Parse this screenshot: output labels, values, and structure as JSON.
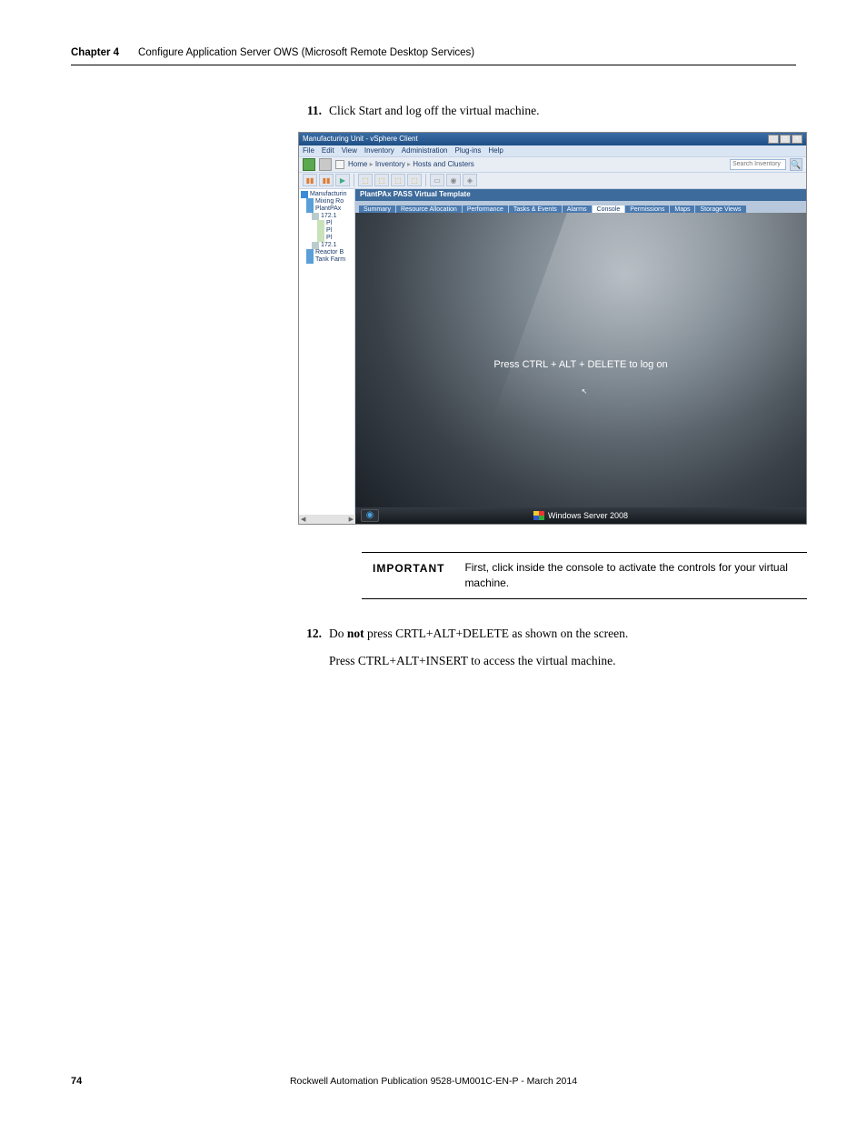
{
  "header": {
    "chapter_label": "Chapter 4",
    "chapter_title": "Configure Application Server OWS (Microsoft Remote Desktop Services)"
  },
  "steps": {
    "s11": {
      "num": "11.",
      "text": "Click Start and log off the virtual machine."
    },
    "s12": {
      "num": "12.",
      "line1_a": "Do ",
      "line1_bold": "not",
      "line1_c": " press CRTL+ALT+DELETE as shown on the screen.",
      "line2": "Press CTRL+ALT+INSERT to access the virtual machine."
    }
  },
  "important": {
    "label": "IMPORTANT",
    "text": "First, click inside the console to activate the controls for your virtual machine."
  },
  "vsphere": {
    "title": "Manufacturing Unit - vSphere Client",
    "menus": [
      "File",
      "Edit",
      "View",
      "Inventory",
      "Administration",
      "Plug-ins",
      "Help"
    ],
    "breadcrumb": {
      "home": "Home",
      "inv": "Inventory",
      "hosts": "Hosts and Clusters"
    },
    "search_placeholder": "Search Inventory",
    "tree": {
      "root": "Manufacturin",
      "nodes": [
        "Mixing Ro",
        "PlantPAx",
        "172.1",
        "Pl",
        "Pl",
        "Pl",
        "172.1",
        "Reactor B",
        "Tank Farm"
      ]
    },
    "right_header": "PlantPAx PASS Virtual Template",
    "tabs": [
      "Summary",
      "Resource Allocation",
      "Performance",
      "Tasks & Events",
      "Alarms",
      "Console",
      "Permissions",
      "Maps",
      "Storage Views"
    ],
    "login_text": "Press CTRL + ALT + DELETE to log on",
    "brand": "Windows Server 2008"
  },
  "footer": {
    "page": "74",
    "pub": "Rockwell Automation Publication 9528-UM001C-EN-P - March 2014"
  }
}
